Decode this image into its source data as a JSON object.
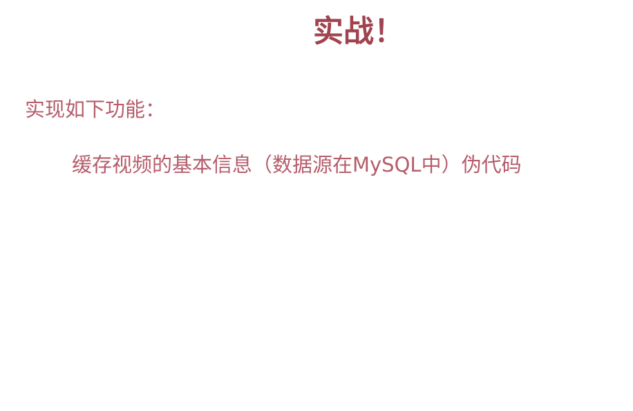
{
  "colors": {
    "title": "#a1434f",
    "body": "#b55d6b",
    "background": "#ffffff"
  },
  "slide": {
    "title": "实战！",
    "intro": "实现如下功能：",
    "bullet": "缓存视频的基本信息（数据源在MySQL中）伪代码"
  }
}
